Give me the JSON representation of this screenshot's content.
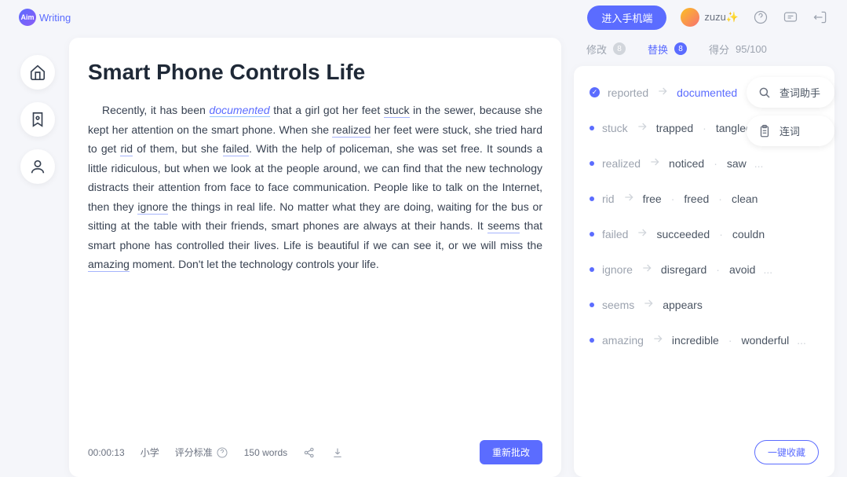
{
  "header": {
    "logo_prefix": "Aim",
    "logo_text": "Writing",
    "mobile_button": "进入手机端",
    "username": "zuzu✨"
  },
  "essay": {
    "title": "Smart Phone Controls Life",
    "body_parts": {
      "p1": "Recently, it has been ",
      "w1": "documented",
      "p2": " that a girl got her feet ",
      "w2": "stuck",
      "p3": " in the sewer, because she kept her attention on the smart phone. When she ",
      "w3": "realized",
      "p4": " her feet were stuck, she tried hard to get ",
      "w4": "rid",
      "p5": " of them, but she ",
      "w5": "failed",
      "p6": ". With the help of    policeman, she was set free. It sounds a little ridiculous, but when we look at the people around, we can find that the new technology distracts their attention from face to face communication. People like to talk on the Internet, then they ",
      "w6": "ignore",
      "p7": " the things in real life. No matter what they are doing, waiting for the bus or sitting at the table with their friends, smart phones are always at their hands. It ",
      "w7": "seems",
      "p8": " that smart phone has controlled their lives. Life is beautiful if we can see it, or we will miss the ",
      "w8": "amazing",
      "p9": " moment. Don't let the technology controls your life."
    },
    "footer": {
      "timer": "00:00:13",
      "level": "小学",
      "criteria": "评分标准",
      "wordcount": "150 words",
      "recheck": "重新批改"
    }
  },
  "tabs": {
    "corrections": {
      "label": "修改",
      "count": "8"
    },
    "replace": {
      "label": "替换",
      "count": "8"
    },
    "score": {
      "label": "得分",
      "value": "95/100"
    }
  },
  "suggestions": [
    {
      "selected": true,
      "orig": "reported",
      "alts": [
        "documented"
      ]
    },
    {
      "selected": false,
      "orig": "stuck",
      "alts": [
        "trapped",
        "tangled"
      ],
      "more": true
    },
    {
      "selected": false,
      "orig": "realized",
      "alts": [
        "noticed",
        "saw"
      ],
      "more": true
    },
    {
      "selected": false,
      "orig": "rid",
      "alts": [
        "free",
        "freed",
        "clean"
      ]
    },
    {
      "selected": false,
      "orig": "failed",
      "alts": [
        "succeeded",
        "couldn"
      ]
    },
    {
      "selected": false,
      "orig": "ignore",
      "alts": [
        "disregard",
        "avoid"
      ],
      "more": true
    },
    {
      "selected": false,
      "orig": "seems",
      "alts": [
        "appears"
      ]
    },
    {
      "selected": false,
      "orig": "amazing",
      "alts": [
        "incredible",
        "wonderful"
      ],
      "more": true
    }
  ],
  "favorite_button": "一键收藏",
  "tools": {
    "dictionary": "查词助手",
    "conjunction": "连词"
  }
}
